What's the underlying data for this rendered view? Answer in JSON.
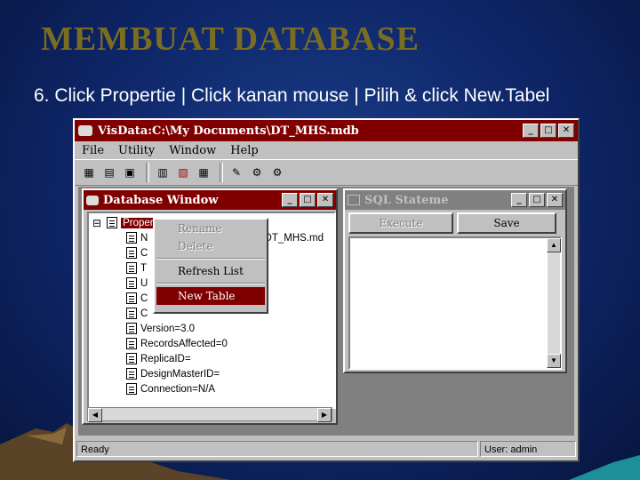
{
  "slide": {
    "title": "MEMBUAT DATABASE",
    "subtitle": "6. Click Propertie | Click kanan mouse | Pilih & click New.Tabel"
  },
  "app": {
    "title": "VisData:C:\\My Documents\\DT_MHS.mdb",
    "menu": [
      "File",
      "Utility",
      "Window",
      "Help"
    ],
    "window_controls": {
      "minimize": "_",
      "maximize": "□",
      "close": "✕"
    }
  },
  "database_window": {
    "title": "Database Window",
    "tree": {
      "root": "Properties",
      "collapse_glyph": "⊟",
      "items": [
        {
          "prefix": "N",
          "suffix": "\\DT_MHS.md"
        },
        {
          "prefix": "C",
          "suffix": ""
        },
        {
          "prefix": "T",
          "suffix": ""
        },
        {
          "prefix": "U",
          "suffix": ""
        },
        {
          "prefix": "C",
          "suffix": ""
        },
        {
          "prefix": "C",
          "suffix": ""
        },
        {
          "prefix": "Version=3.0",
          "suffix": ""
        },
        {
          "prefix": "RecordsAffected=0",
          "suffix": ""
        },
        {
          "prefix": "ReplicaID=",
          "suffix": ""
        },
        {
          "prefix": "DesignMasterID=",
          "suffix": ""
        },
        {
          "prefix": "Connection=N/A",
          "suffix": ""
        }
      ]
    }
  },
  "context_menu": {
    "rename": "Rename",
    "delete": "Delete",
    "refresh_list": "Refresh List",
    "new_table": "New Table"
  },
  "sql_window": {
    "title": "SQL Stateme",
    "execute_label": "Execute",
    "save_label": "Save"
  },
  "status": {
    "ready": "Ready",
    "user": "User: admin"
  },
  "colors": {
    "title_color": "#7a6d22",
    "active_titlebar": "#800000",
    "background": "#0e2566"
  }
}
